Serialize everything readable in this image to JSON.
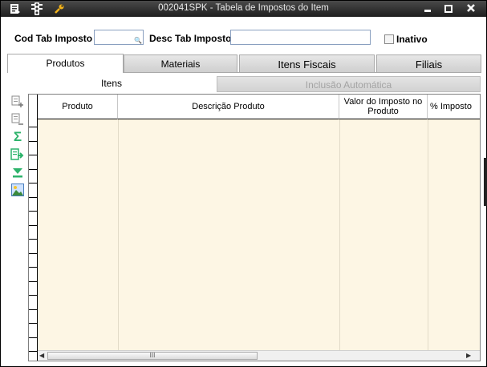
{
  "window": {
    "title": "002041SPK - Tabela de Impostos do Item"
  },
  "title_icons": [
    "list-icon",
    "traffic-light-icon",
    "wrench-icon"
  ],
  "form": {
    "cod_label": "Cod Tab Imposto",
    "cod_value": "",
    "desc_label": "Desc Tab Imposto",
    "desc_value": "",
    "inativo_label": "Inativo",
    "inativo_checked": false
  },
  "tabs": [
    {
      "label": "Produtos",
      "active": true
    },
    {
      "label": "Materiais",
      "active": false
    },
    {
      "label": "Itens Fiscais",
      "active": false
    },
    {
      "label": "Filiais",
      "active": false
    }
  ],
  "subtabs": [
    {
      "label": "Itens",
      "active": true
    },
    {
      "label": "Inclusão Automática",
      "enabled": false
    }
  ],
  "toolbar_icons": [
    "add-row-icon",
    "remove-row-icon",
    "sum-icon",
    "export-icon",
    "download-icon",
    "image-icon"
  ],
  "grid": {
    "columns": [
      "Produto",
      "Descrição Produto",
      "Valor do Imposto no Produto",
      "% Imposto"
    ],
    "rows": [],
    "scroll_thumb_label": "III"
  },
  "colors": {
    "title_bg": "#2b2b2b",
    "grid_bg": "#fdf6e4",
    "accent_green": "#2db36b"
  }
}
